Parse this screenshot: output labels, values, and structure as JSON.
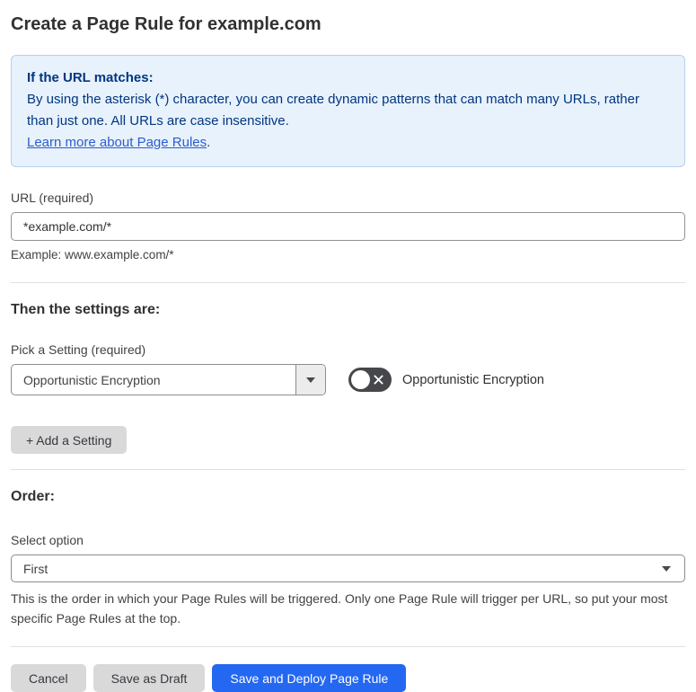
{
  "page": {
    "title": "Create a Page Rule for example.com"
  },
  "info_box": {
    "heading": "If the URL matches:",
    "body": "By using the asterisk (*) character, you can create dynamic patterns that can match many URLs, rather than just one. All URLs are case insensitive.",
    "link_label": "Learn more about Page Rules",
    "link_suffix": "."
  },
  "url_field": {
    "label": "URL (required)",
    "value": "*example.com/*",
    "example": "Example: www.example.com/*"
  },
  "settings_section": {
    "heading": "Then the settings are:",
    "picker_label": "Pick a Setting (required)",
    "selected_setting": "Opportunistic Encryption",
    "toggle_label": "Opportunistic Encryption",
    "toggle_state": "off",
    "add_setting_button": "+ Add a Setting"
  },
  "order_section": {
    "heading": "Order:",
    "select_label": "Select option",
    "selected_option": "First",
    "help_text": "This is the order in which your Page Rules will be triggered. Only one Page Rule will trigger per URL, so put your most specific Page Rules at the top."
  },
  "footer": {
    "cancel_label": "Cancel",
    "save_draft_label": "Save as Draft",
    "save_deploy_label": "Save and Deploy Page Rule"
  },
  "colors": {
    "accent_blue": "#2468f2",
    "info_bg": "#e8f2fc",
    "info_border": "#b5d0ee",
    "info_text": "#003681",
    "link_blue": "#2c5dcf"
  }
}
